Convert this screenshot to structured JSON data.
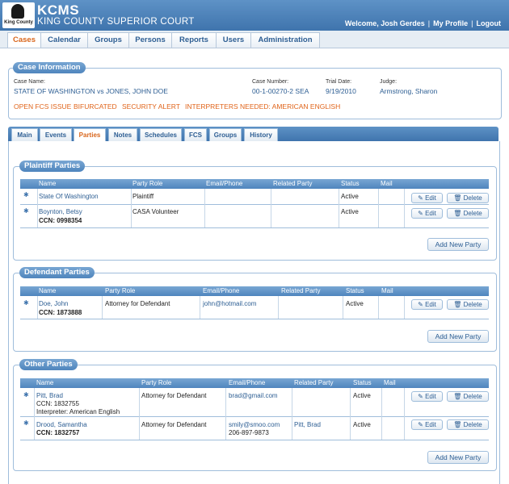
{
  "app": {
    "name": "KCMS",
    "court": "KING COUNTY SUPERIOR COURT",
    "logo_text": "King County"
  },
  "user": {
    "welcome": "Welcome, Josh Gerdes",
    "profile": "My Profile",
    "logout": "Logout"
  },
  "nav": [
    "Cases",
    "Calendar",
    "Groups",
    "Persons",
    "Reports",
    "Users",
    "Administration"
  ],
  "case": {
    "legend": "Case Information",
    "name_label": "Case Name:",
    "name": "STATE OF WASHINGTON vs JONES, JOHN DOE",
    "number_label": "Case Number:",
    "number": "00-1-00270-2 SEA",
    "trial_label": "Trial Date:",
    "trial": "9/19/2010",
    "judge_label": "Judge:",
    "judge": "Armstrong, Sharon",
    "alerts": [
      "OPEN FCS ISSUE",
      "BIFURCATED",
      "SECURITY ALERT",
      "INTERPRETERS NEEDED: AMERICAN ENGLISH"
    ]
  },
  "tabs": [
    "Main",
    "Events",
    "Parties",
    "Notes",
    "Schedules",
    "FCS",
    "Groups",
    "History"
  ],
  "buttons": {
    "edit": "Edit",
    "delete": "Delete",
    "add": "Add New Party"
  },
  "plaintiff": {
    "legend": "Plaintiff Parties",
    "columns": [
      "Name",
      "Party Role",
      "Email/Phone",
      "Related Party",
      "Status",
      "Mail"
    ],
    "rows": [
      {
        "name": "State Of Washington",
        "ccn": "",
        "interp": "",
        "role": "Plaintiff",
        "email": "",
        "phone": "",
        "related": "",
        "status": "Active"
      },
      {
        "name": "Boynton, Betsy",
        "ccn": "CCN: 0998354",
        "interp": "",
        "role": "CASA Volunteer",
        "email": "",
        "phone": "",
        "related": "",
        "status": "Active"
      }
    ]
  },
  "defendant": {
    "legend": "Defendant Parties",
    "columns": [
      "Name",
      "Party Role",
      "Email/Phone",
      "Related Party",
      "Status",
      "Mail"
    ],
    "rows": [
      {
        "name": "Doe, John",
        "ccn": "CCN: 1873888",
        "interp": "",
        "role": "Attorney for Defendant",
        "email": "john@hotmail.com",
        "phone": "",
        "related": "",
        "status": "Active"
      }
    ]
  },
  "other": {
    "legend": "Other Parties",
    "columns": [
      "Name",
      "Party Role",
      "Email/Phone",
      "Related Party",
      "Status",
      "Mail"
    ],
    "rows": [
      {
        "name": "Pitt, Brad",
        "ccn": "CCN: 1832755",
        "interp": "Interpreter:  American English",
        "role": "Attorney for Defendant",
        "email": "brad@gmail.com",
        "phone": "",
        "related": "",
        "status": "Active"
      },
      {
        "name": "Drood, Samantha",
        "ccn": "CCN: 1832757",
        "interp": "",
        "role": "Attorney for Defendant",
        "email": "smily@smoo.com",
        "phone": "206-897-9873",
        "related": "Pitt, Brad",
        "status": "Active"
      }
    ]
  },
  "colors": {
    "header": "#3f74ad",
    "accent": "#d9661c",
    "link": "#2d5e93"
  }
}
